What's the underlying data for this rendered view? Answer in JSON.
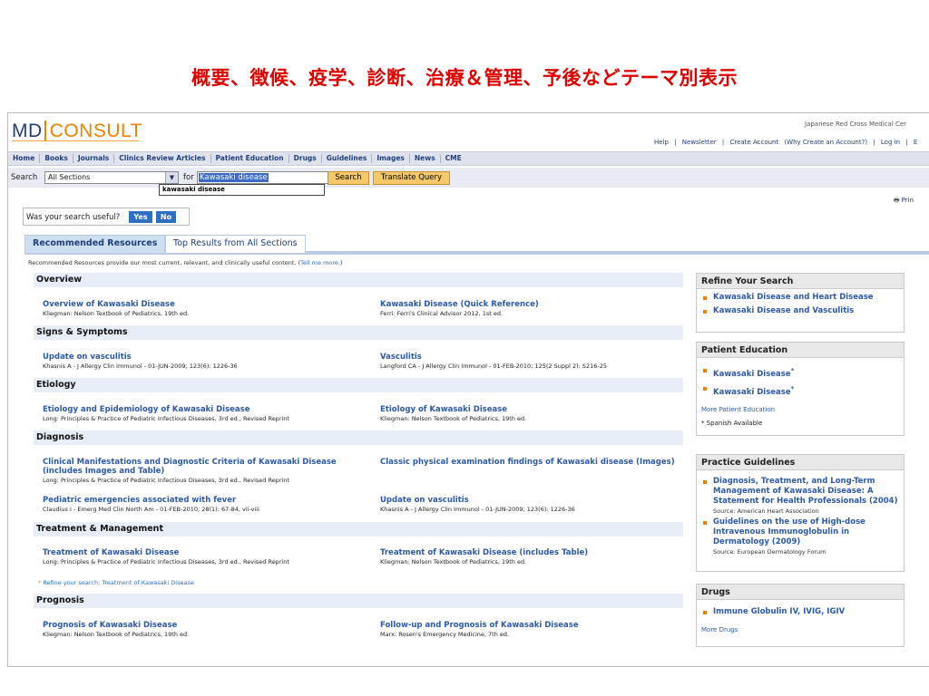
{
  "slide_title": "概要、徴候、疫学、診断、治療＆管理、予後などテーマ別表示",
  "header": {
    "logo_md": "MD",
    "logo_consult": "CONSULT",
    "org": "Japanese Red Cross Medical Cer",
    "links": [
      "Help",
      "|",
      "Newsletter",
      "|",
      "Create Account",
      "(Why Create an Account?)",
      "|",
      "Log in",
      "|",
      "E"
    ]
  },
  "nav": [
    "Home",
    "Books",
    "Journals",
    "Clinics Review Articles",
    "Patient Education",
    "Drugs",
    "Guidelines",
    "Images",
    "News",
    "CME"
  ],
  "search": {
    "label": "Search",
    "section": "All Sections",
    "for": "for",
    "query": "Kawasaki disease",
    "suggestion": "kawasaki disease",
    "search_button": "Search",
    "translate_button": "Translate Query"
  },
  "print": "Prin",
  "useful": {
    "question": "Was your search useful?",
    "yes": "Yes",
    "no": "No"
  },
  "tabs": {
    "recommended": "Recommended Resources",
    "top": "Top Results from All Sections"
  },
  "intro": {
    "text": "Recommended Resources provide our most current, relevant, and clinically useful content. (",
    "link": "Tell me more.",
    "close": ")"
  },
  "sections": {
    "overview": {
      "title": "Overview",
      "left": {
        "title": "Overview of Kawasaki Disease",
        "source": "Kliegman: Nelson Textbook of Pediatrics, 19th ed."
      },
      "right": {
        "title": "Kawasaki Disease (Quick Reference)",
        "source": "Ferri: Ferri's Clinical Advisor 2012, 1st ed."
      }
    },
    "signs": {
      "title": "Signs & Symptoms",
      "left": {
        "title": "Update on vasculitis",
        "source": "Khasnis A - J Allergy Clin Immunol - 01-JUN-2009; 123(6): 1226-36"
      },
      "right": {
        "title": "Vasculitis",
        "source": "Langford CA - J Allergy Clin Immunol - 01-FEB-2010; 125(2 Suppl 2): S216-25"
      }
    },
    "etiology": {
      "title": "Etiology",
      "left": {
        "title": "Etiology and Epidemiology of Kawasaki Disease",
        "source": "Long: Principles & Practice of Pediatric Infectious Diseases, 3rd ed., Revised Reprint"
      },
      "right": {
        "title": "Etiology of Kawasaki Disease",
        "source": "Kliegman: Nelson Textbook of Pediatrics, 19th ed."
      }
    },
    "diagnosis": {
      "title": "Diagnosis",
      "left1": {
        "title": "Clinical Manifestations and Diagnostic Criteria of Kawasaki Disease (includes Images and Table)",
        "source": "Long: Principles & Practice of Pediatric Infectious Diseases, 3rd ed., Revised Reprint"
      },
      "right1": {
        "title": "Classic physical examination findings of Kawasaki disease (Images)"
      },
      "left2": {
        "title": "Pediatric emergencies associated with fever",
        "source": "Claudius I - Emerg Med Clin North Am - 01-FEB-2010; 28(1): 67-84, vii-viii"
      },
      "right2": {
        "title": "Update on vasculitis",
        "source": "Khasnis A - J Allergy Clin Immunol - 01-JUN-2009; 123(6): 1226-36"
      }
    },
    "treatment": {
      "title": "Treatment & Management",
      "left": {
        "title": "Treatment of Kawasaki Disease",
        "source": "Long: Principles & Practice of Pediatric Infectious Diseases, 3rd ed., Revised Reprint"
      },
      "right": {
        "title": "Treatment of Kawasaki Disease (includes Table)",
        "source": "Kliegman: Nelson Textbook of Pediatrics, 19th ed."
      },
      "refine": "Refine your search: Treatment of Kawasaki Disease"
    },
    "prognosis": {
      "title": "Prognosis",
      "left": {
        "title": "Prognosis of Kawasaki Disease",
        "source": "Kliegman: Nelson Textbook of Pediatrics, 19th ed."
      },
      "right": {
        "title": "Follow-up and Prognosis of Kawasaki Disease",
        "source": "Marx: Rosen's Emergency Medicine, 7th ed."
      }
    }
  },
  "sidebar": {
    "refine": {
      "title": "Refine Your Search",
      "items": [
        "Kawasaki Disease and Heart Disease",
        "Kawasaki Disease and Vasculitis"
      ]
    },
    "patient": {
      "title": "Patient Education",
      "items": [
        "Kawasaki Disease",
        "Kawasaki Disease"
      ],
      "more": "More Patient Education",
      "note": "* Spanish Available"
    },
    "guidelines": {
      "title": "Practice Guidelines",
      "items": [
        {
          "title": "Diagnosis, Treatment, and Long-Term Management of Kawasaki Disease: A Statement for Health Professionals (2004)",
          "source": "Source: American Heart Association"
        },
        {
          "title": "Guidelines on the use of High-dose Intravenous Immunoglobulin in Dermatology (2009)",
          "source": "Source: European Dermatology Forum"
        }
      ]
    },
    "drugs": {
      "title": "Drugs",
      "items": [
        "Immune Globulin IV, IVIG, IGIV"
      ],
      "more": "More Drugs"
    }
  }
}
